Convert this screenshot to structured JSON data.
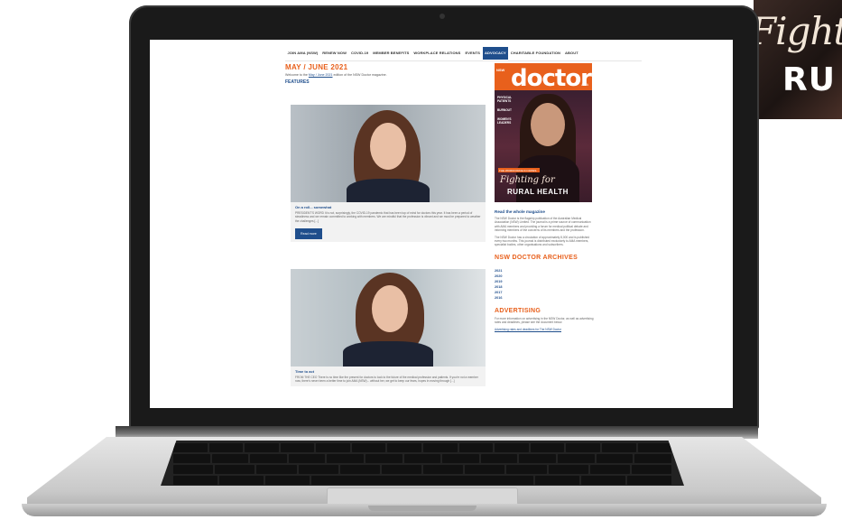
{
  "background": {
    "magazine_script": "Fightin",
    "magazine_bold": "RU"
  },
  "nav": {
    "items": [
      "JOIN AMA (NSW)",
      "RENEW NOW",
      "COVID-19",
      "MEMBER BENEFITS",
      "WORKPLACE RELATIONS",
      "EVENTS",
      "ADVOCACY",
      "CHARITABLE FOUNDATION",
      "ABOUT"
    ],
    "active": "ADVOCACY"
  },
  "main": {
    "issue_title": "MAY / JUNE 2021",
    "welcome_prefix": "Welcome to the",
    "welcome_link": "May / June 2021",
    "welcome_suffix": "edition of the NSW Doctor magazine.",
    "features_heading": "FEATURES",
    "cards": [
      {
        "title": "On a roll... somewhat",
        "text": "PRESIDENT'S WORD It is not, surprisingly, the COVID-19 pandemic that has been top of mind for doctors this year. It has been a period of steadiness and we remain committed to working with members. We are mindful that the profession is vibrant and we must be prepared to weather the challenges [...]",
        "button": "Read more"
      },
      {
        "title": "Time to act",
        "text": "FROM THE CEO There is no time like the present for doctors to look to the future of the medical profession and patients. If you're not a member now, there's never been a better time to join AMA (NSW)... without her, we get to keep our fears, hopes in moving through [...]"
      }
    ]
  },
  "sidebar": {
    "cover": {
      "masthead": "doctor",
      "nsw": "NSW",
      "brand": "AMA",
      "blurbs": [
        "PHYSICAL PATIENTS",
        "BURNOUT",
        "WOMEN'S LEADERS"
      ],
      "strip": "THE WORKFORCE IN CRISIS",
      "headline_script": "Fighting for",
      "headline_bold": "RURAL HEALTH"
    },
    "read_heading": "Read the whole magazine",
    "read_p1": "The NSW Doctor is the flagship publication of the Australian Medical Association (NSW) Limited. The journal is a prime source of communication with AMA members and providing a forum for medical political debate and informing members of the concerns of its members and the profession.",
    "read_p2": "The NSW Doctor has a circulation of approximately 8,000 and is published every two months. This journal is distributed exclusively to AMA members, specialist bodies, other organisations and subscribers.",
    "archives_heading": "NSW DOCTOR ARCHIVES",
    "years": [
      "2021",
      "2020",
      "2019",
      "2018",
      "2017",
      "2016"
    ],
    "advertising_heading": "ADVERTISING",
    "advertising_text": "For more information on advertising in the NSW Doctor, as well as advertising rates and deadlines, please see the document below.",
    "advertising_link": "Advertising rates and deadlines for The NSW Doctor"
  }
}
